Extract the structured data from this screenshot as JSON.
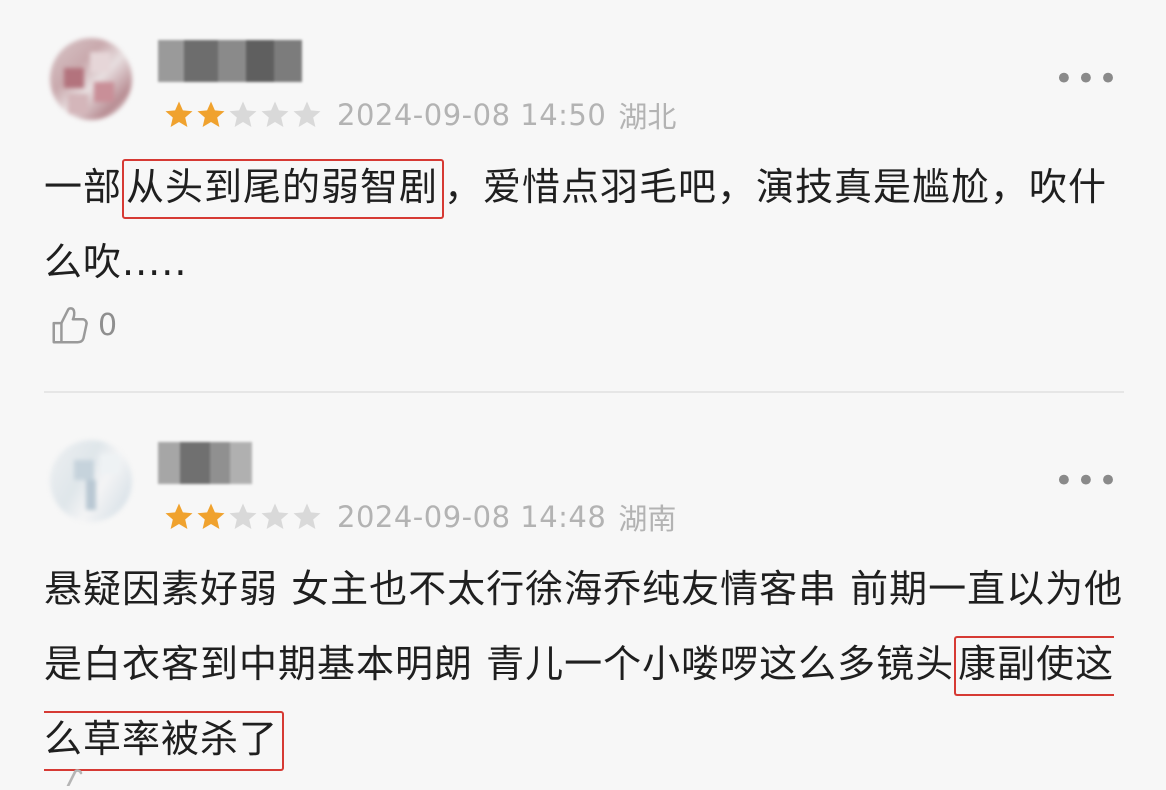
{
  "colors": {
    "background": "#f7f7f7",
    "star_filled": "#f0a22e",
    "star_empty": "#d9d9d9",
    "meta_text": "#b3b3b3",
    "highlight_border": "#d63a34"
  },
  "comments": [
    {
      "rating": 2,
      "rating_max": 5,
      "date": "2024-09-08 14:50",
      "region": "湖北",
      "text_before": "一部",
      "text_highlight": "从头到尾的弱智剧",
      "text_after": "，爱惜点羽毛吧，演技真是尴尬，吹什么吹.....",
      "likes": "0",
      "more_icon": "more-dots-icon"
    },
    {
      "rating": 2,
      "rating_max": 5,
      "date": "2024-09-08 14:48",
      "region": "湖南",
      "text_before": "悬疑因素好弱  女主也不太行徐海乔纯友情客串  前期一直以为他是白衣客到中期基本明朗   青儿一个小喽啰这么多镜头",
      "text_highlight": "康副使这么草率被杀了",
      "text_after": "",
      "more_icon": "more-dots-icon"
    }
  ]
}
